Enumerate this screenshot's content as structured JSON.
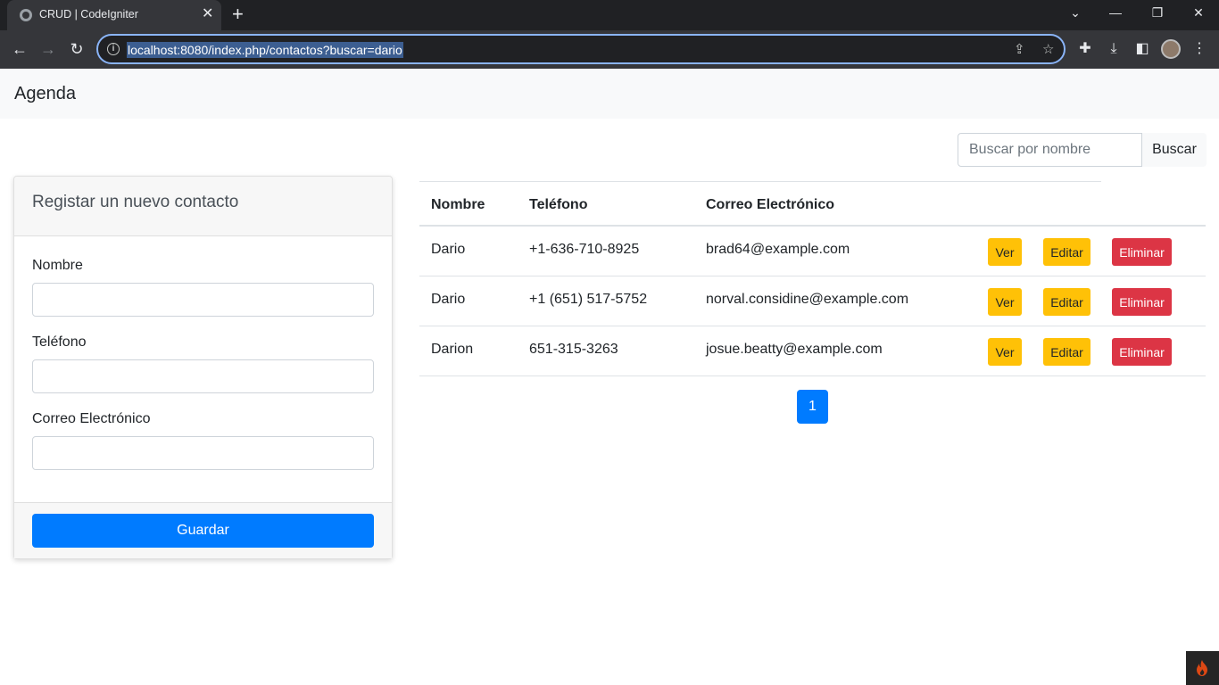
{
  "browser": {
    "tab_title": "CRUD | CodeIgniter",
    "tab_close": "✕",
    "new_tab": "+",
    "url": "localhost:8080/index.php/contactos?buscar=dario"
  },
  "navbar": {
    "brand": "Agenda"
  },
  "search": {
    "placeholder": "Buscar por nombre",
    "button": "Buscar"
  },
  "form": {
    "title": "Registar un nuevo contacto",
    "fields": [
      {
        "label": "Nombre",
        "value": ""
      },
      {
        "label": "Teléfono",
        "value": ""
      },
      {
        "label": "Correo Electrónico",
        "value": ""
      }
    ],
    "submit": "Guardar"
  },
  "table": {
    "headers": [
      "Nombre",
      "Teléfono",
      "Correo Electrónico"
    ],
    "rows": [
      {
        "nombre": "Dario",
        "telefono": "+1-636-710-8925",
        "correo": "brad64@example.com"
      },
      {
        "nombre": "Dario",
        "telefono": "+1 (651) 517-5752",
        "correo": "norval.considine@example.com"
      },
      {
        "nombre": "Darion",
        "telefono": "651-315-3263",
        "correo": "josue.beatty@example.com"
      }
    ],
    "actions": {
      "view": "Ver",
      "edit": "Editar",
      "delete": "Eliminar"
    }
  },
  "pagination": {
    "current": "1"
  },
  "colors": {
    "primary": "#007bff",
    "warning": "#ffc107",
    "danger": "#dc3545"
  }
}
